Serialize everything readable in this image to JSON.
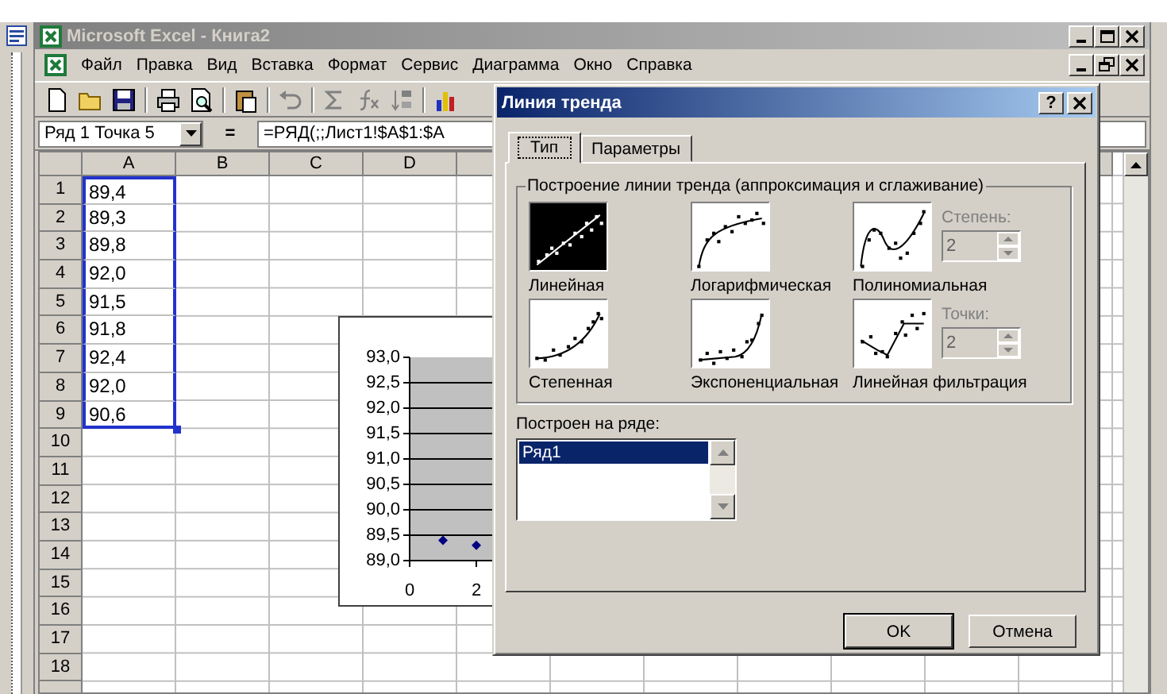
{
  "window": {
    "title": "Microsoft Excel - Книга2"
  },
  "menu": [
    "Файл",
    "Правка",
    "Вид",
    "Вставка",
    "Формат",
    "Сервис",
    "Диаграмма",
    "Окно",
    "Справка"
  ],
  "name_box": {
    "value": "Ряд 1 Точка 5"
  },
  "formula_bar": {
    "equals": "=",
    "value": "=РЯД(;;Лист1!$A$1:$A"
  },
  "sheet": {
    "columns": [
      "A",
      "B",
      "C",
      "D"
    ],
    "rows": [
      {
        "header": "1",
        "value": "89,4",
        "selected": true
      },
      {
        "header": "2",
        "value": "89,3",
        "selected": true
      },
      {
        "header": "3",
        "value": "89,8",
        "selected": true
      },
      {
        "header": "4",
        "value": "92,0",
        "selected": true
      },
      {
        "header": "5",
        "value": "91,5",
        "selected": true
      },
      {
        "header": "6",
        "value": "91,8",
        "selected": true
      },
      {
        "header": "7",
        "value": "92,4",
        "selected": true
      },
      {
        "header": "8",
        "value": "92,0",
        "selected": true
      },
      {
        "header": "9",
        "value": "90,6",
        "selected": true
      },
      {
        "header": "10",
        "selected": false
      },
      {
        "header": "11",
        "selected": false
      },
      {
        "header": "12",
        "selected": false
      },
      {
        "header": "13",
        "selected": false
      },
      {
        "header": "14",
        "selected": false
      },
      {
        "header": "15",
        "selected": false
      },
      {
        "header": "16",
        "selected": false
      },
      {
        "header": "17",
        "selected": false
      },
      {
        "header": "18",
        "selected": false
      }
    ]
  },
  "chart": {
    "chart_data": {
      "type": "scatter",
      "x": [
        1,
        2
      ],
      "series": [
        {
          "color": "#000080",
          "values": [
            89.4,
            89.3
          ]
        }
      ],
      "xlim": [
        0,
        10
      ],
      "ylim": [
        89,
        93
      ],
      "grid": true,
      "yticks": [
        {
          "value": 89,
          "label": "89,0"
        },
        {
          "value": 89.5,
          "label": "89,5"
        },
        {
          "value": 90,
          "label": "90,0"
        },
        {
          "value": 90.5,
          "label": "90,5"
        },
        {
          "value": 91,
          "label": "91,0"
        },
        {
          "value": 91.5,
          "label": "91,5"
        },
        {
          "value": 92,
          "label": "92,0"
        },
        {
          "value": 92.5,
          "label": "92,5"
        },
        {
          "value": 93,
          "label": "93,0"
        }
      ],
      "xticks": [
        {
          "value": 0,
          "label": "0"
        },
        {
          "value": 2,
          "label": "2"
        }
      ]
    }
  },
  "dialog": {
    "title": "Линия тренда",
    "help": "?",
    "tabs": [
      {
        "label": "Тип",
        "selected": true
      },
      {
        "label": "Параметры",
        "selected": false
      }
    ],
    "group_title": "Построение линии тренда (аппроксимация и сглаживание)",
    "trend_types": [
      {
        "label": "Линейная",
        "kind": "linear",
        "selected": true
      },
      {
        "label": "Логарифмическая",
        "kind": "log",
        "selected": false
      },
      {
        "label": "Полиномиальная",
        "kind": "poly",
        "selected": false,
        "option": {
          "label": "Степень:",
          "value": "2",
          "disabled": true
        }
      },
      {
        "label": "Степенная",
        "kind": "power",
        "selected": false
      },
      {
        "label": "Экспоненциальная",
        "kind": "exp",
        "selected": false
      },
      {
        "label": "Линейная фильтрация",
        "kind": "moving",
        "selected": false,
        "option": {
          "label": "Точки:",
          "value": "2",
          "disabled": true
        }
      }
    ],
    "series_label": "Построен на ряде:",
    "series_list": [
      {
        "label": "Ряд1",
        "selected": true
      }
    ],
    "buttons": [
      {
        "label": "OK",
        "default": true
      },
      {
        "label": "Отмена",
        "default": false
      }
    ]
  }
}
